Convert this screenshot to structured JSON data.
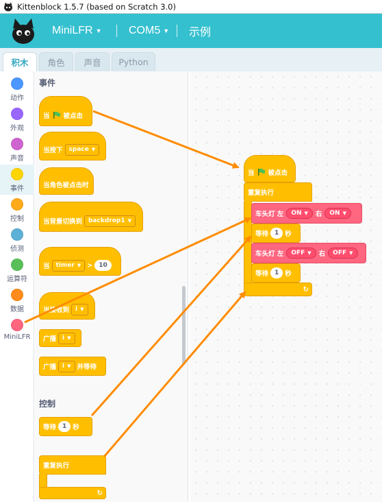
{
  "window": {
    "title": "Kittenblock 1.5.7 (based on Scratch 3.0)"
  },
  "topbar": {
    "device": "MiniLFR",
    "port": "COM5",
    "examples": "示例"
  },
  "tabs": [
    "积木",
    "角色",
    "声音",
    "Python"
  ],
  "categories": [
    {
      "label": "动作",
      "color": "#4c97ff"
    },
    {
      "label": "外观",
      "color": "#9966ff"
    },
    {
      "label": "声音",
      "color": "#cf63cf"
    },
    {
      "label": "事件",
      "color": "#ffd500"
    },
    {
      "label": "控制",
      "color": "#ffab19"
    },
    {
      "label": "侦测",
      "color": "#5cb1d6"
    },
    {
      "label": "运算符",
      "color": "#59c059"
    },
    {
      "label": "数据",
      "color": "#ff8c1a"
    },
    {
      "label": "MiniLFR",
      "color": "#ff6680"
    }
  ],
  "palette": {
    "events_heading": "事件",
    "control_heading": "控制",
    "when_flag_a": "当",
    "when_flag_b": "被点击",
    "when_key": "当按下",
    "key_value": "space",
    "when_sprite_clicked": "当角色被点击时",
    "when_backdrop": "当背景切换到",
    "backdrop_value": "backdrop1",
    "when_timer": "当",
    "timer_value": "timer",
    "gt": ">",
    "timer_num": "10",
    "when_receive": "当接收到",
    "msg_value": "i",
    "broadcast": "广播",
    "broadcast_value": "i",
    "broadcast_wait_a": "广播",
    "broadcast_wait_value": "i",
    "broadcast_wait_b": "并等待",
    "wait_a": "等待",
    "wait_num": "1",
    "wait_b": "秒",
    "forever": "重复执行"
  },
  "script": {
    "hat_a": "当",
    "hat_b": "被点击",
    "forever": "重复执行",
    "light1_label": "车头灯 左",
    "light1_left": "ON",
    "light1_mid": "右",
    "light1_right": "ON",
    "wait1_a": "等待",
    "wait1_num": "1",
    "wait1_b": "秒",
    "light2_label": "车头灯 左",
    "light2_left": "OFF",
    "light2_mid": "右",
    "light2_right": "OFF",
    "wait2_a": "等待",
    "wait2_num": "1",
    "wait2_b": "秒"
  },
  "colors": {
    "accent": "#35c0cf",
    "events": "#ffbf00",
    "minilfr": "#ff6680",
    "arrow": "#ff8c00"
  }
}
